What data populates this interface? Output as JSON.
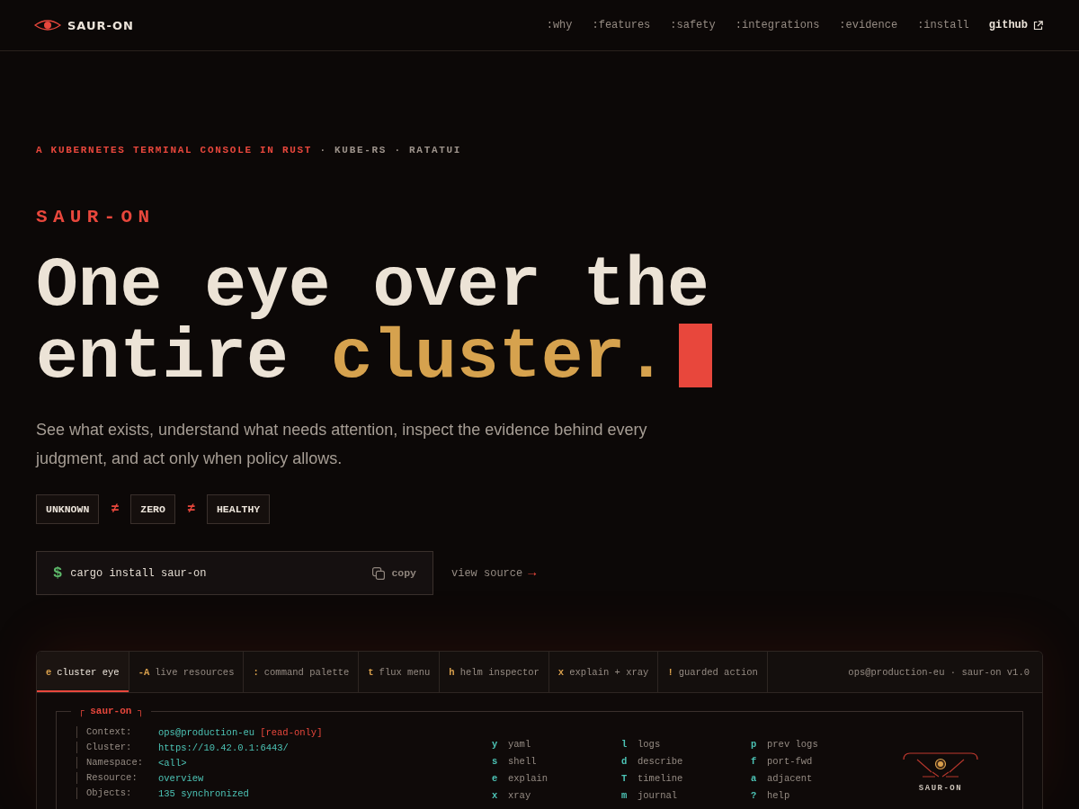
{
  "header": {
    "brand": "SAUR-ON",
    "nav": [
      {
        "label": ":why"
      },
      {
        "label": ":features"
      },
      {
        "label": ":safety"
      },
      {
        "label": ":integrations"
      },
      {
        "label": ":evidence"
      },
      {
        "label": ":install"
      }
    ],
    "github": {
      "label": "github"
    }
  },
  "hero": {
    "tagline": {
      "accent": "A KUBERNETES TERMINAL CONSOLE IN RUST",
      "rest": "· KUBE-RS · RATATUI"
    },
    "eyebrow": "SAUR-ON",
    "headline": [
      {
        "text": "One eye over the"
      },
      {
        "text": "entire",
        "accent": "cluster."
      }
    ],
    "lede": "See what exists, understand what needs attention, inspect the evidence behind every judgment, and act only when policy allows.",
    "states": [
      {
        "kind": "chip",
        "text": "UNKNOWN"
      },
      {
        "kind": "separator",
        "text": "≠"
      },
      {
        "kind": "chip",
        "text": "ZERO"
      },
      {
        "kind": "separator",
        "text": "≠"
      },
      {
        "kind": "chip",
        "text": "HEALTHY"
      }
    ],
    "install": {
      "prompt": "$",
      "command": "cargo install saur-on",
      "copy": "copy"
    },
    "view_source": {
      "label": "view source",
      "arrow": "→"
    }
  },
  "console": {
    "tabs": [
      {
        "key": "e",
        "label": "cluster eye",
        "selected": true
      },
      {
        "key": "-A",
        "label": "live resources",
        "selected": false
      },
      {
        "key": ":",
        "label": "command palette",
        "selected": false
      },
      {
        "key": "t",
        "label": "flux menu",
        "selected": false
      },
      {
        "key": "h",
        "label": "helm inspector",
        "selected": false
      },
      {
        "key": "x",
        "label": "explain + xray",
        "selected": false
      },
      {
        "key": "!",
        "label": "guarded action",
        "selected": false
      }
    ],
    "session": "ops@production-eu · saur-on v1.0",
    "panel_title": "┌ saur-on ┐",
    "info": [
      {
        "label": "Context:",
        "value": "ops@production-eu",
        "flag": "[read-only]"
      },
      {
        "label": "Cluster:",
        "value": "https://10.42.0.1:6443/"
      },
      {
        "label": "Namespace:",
        "value": "<all>"
      },
      {
        "label": "Resource:",
        "value": "overview"
      },
      {
        "label": "Objects:",
        "value": "135 synchronized"
      }
    ],
    "keymap": [
      {
        "key": "y",
        "action": "yaml"
      },
      {
        "key": "l",
        "action": "logs"
      },
      {
        "key": "p",
        "action": "prev logs"
      },
      {
        "key": "s",
        "action": "shell"
      },
      {
        "key": "d",
        "action": "describe"
      },
      {
        "key": "f",
        "action": "port-fwd"
      },
      {
        "key": "e",
        "action": "explain"
      },
      {
        "key": "T",
        "action": "timeline"
      },
      {
        "key": "a",
        "action": "adjacent"
      },
      {
        "key": "x",
        "action": "xray"
      },
      {
        "key": "m",
        "action": "journal"
      },
      {
        "key": "?",
        "action": "help"
      }
    ],
    "emblem": {
      "label": "SAUR-ON"
    }
  }
}
